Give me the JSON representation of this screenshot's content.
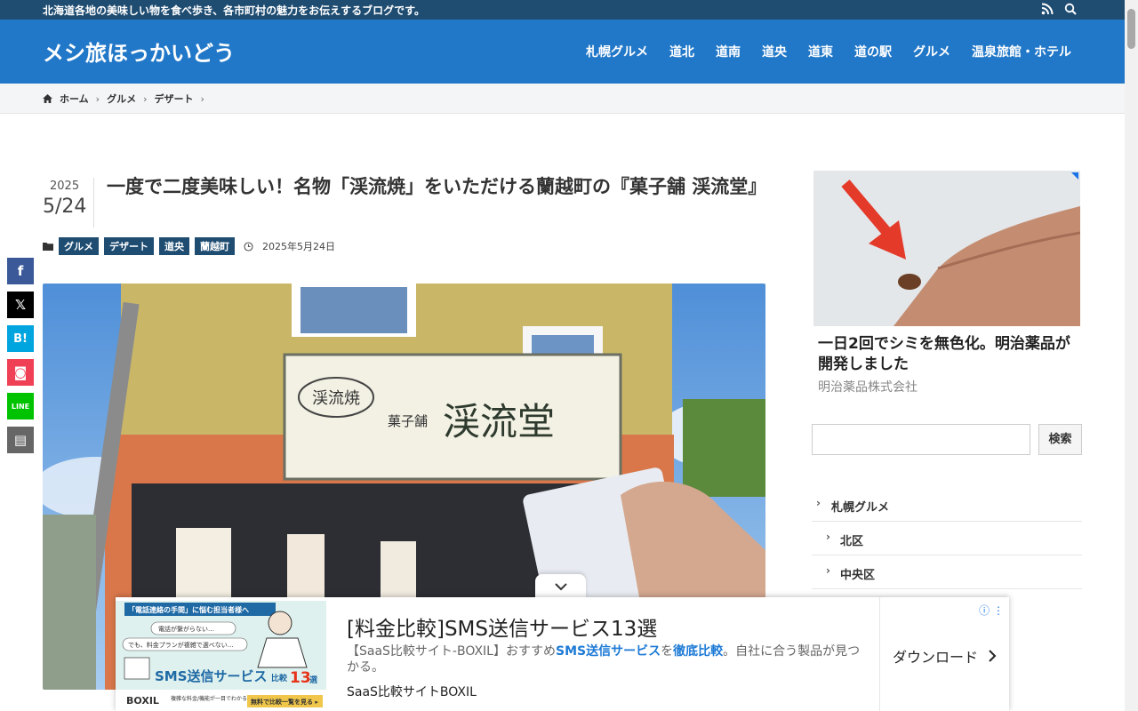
{
  "topbar": {
    "tagline": "北海道各地の美味しい物を食べ歩き、各市町村の魅力をお伝えするブログです。",
    "rss_icon": "rss-icon",
    "search_icon": "search-icon"
  },
  "header": {
    "site_title": "メシ旅ほっかいどう",
    "nav": [
      "札幌グルメ",
      "道北",
      "道南",
      "道央",
      "道東",
      "道の駅",
      "グルメ",
      "温泉旅館・ホテル"
    ]
  },
  "breadcrumb": {
    "items": [
      "ホーム",
      "グルメ",
      "デザート"
    ],
    "home_icon": "home-icon"
  },
  "post": {
    "year": "2025",
    "month_day": "5/24",
    "title": "一度で二度美味しい！名物「渓流焼」をいただける蘭越町の『菓子舗 渓流堂』",
    "tags": [
      "グルメ",
      "デザート",
      "道央",
      "蘭越町"
    ],
    "published": "2025年5月24日",
    "hero_sign_small": "渓流焼",
    "hero_sign_label": "菓子舗",
    "hero_sign_big": "渓流堂"
  },
  "share": {
    "facebook": "f",
    "x": "𝕏",
    "hatena": "B!",
    "pocket": "◙",
    "line": "LINE",
    "copy": "▤"
  },
  "sidebar": {
    "ad_title": "一日2回でシミを無色化。明治薬品が開発しました",
    "ad_source": "明治薬品株式会社",
    "search_button": "検索",
    "search_value": "",
    "categories": [
      {
        "label": "札幌グルメ",
        "level": 0
      },
      {
        "label": "北区",
        "level": 1
      },
      {
        "label": "中央区",
        "level": 1
      }
    ]
  },
  "bottom_ad": {
    "title": "[料金比較]SMS送信サービス13選",
    "desc_pre": "【SaaS比較サイト-BOXIL】おすすめ",
    "desc_hl1": "SMS送信サービス",
    "desc_mid": "を",
    "desc_hl2": "徹底比較",
    "desc_post": "。自社に合う製品が見つかる。",
    "source": "SaaS比較サイトBOXIL",
    "cta": "ダウンロード",
    "img_banner": "「電話連絡の手間」に悩む担当者様へ",
    "img_bubble1": "電話が繋がらない…",
    "img_bubble2": "でも、料金プランが複雑で選べない…",
    "img_service": "SMS送信サービス",
    "img_compare": "比較",
    "img_count": "13",
    "img_count_unit": "選",
    "img_logo": "BOXIL",
    "img_note": "複雑な料金/機能が一目でわかる",
    "img_btn": "無料で比較一覧を見る ▸"
  },
  "colors": {
    "topbar": "#1f4d72",
    "header": "#2278c8",
    "tag": "#1f4d72",
    "facebook": "#3b5998",
    "x": "#000000",
    "hatena": "#00a4de",
    "pocket": "#ef4056",
    "line": "#00c300",
    "copy": "#666666"
  }
}
